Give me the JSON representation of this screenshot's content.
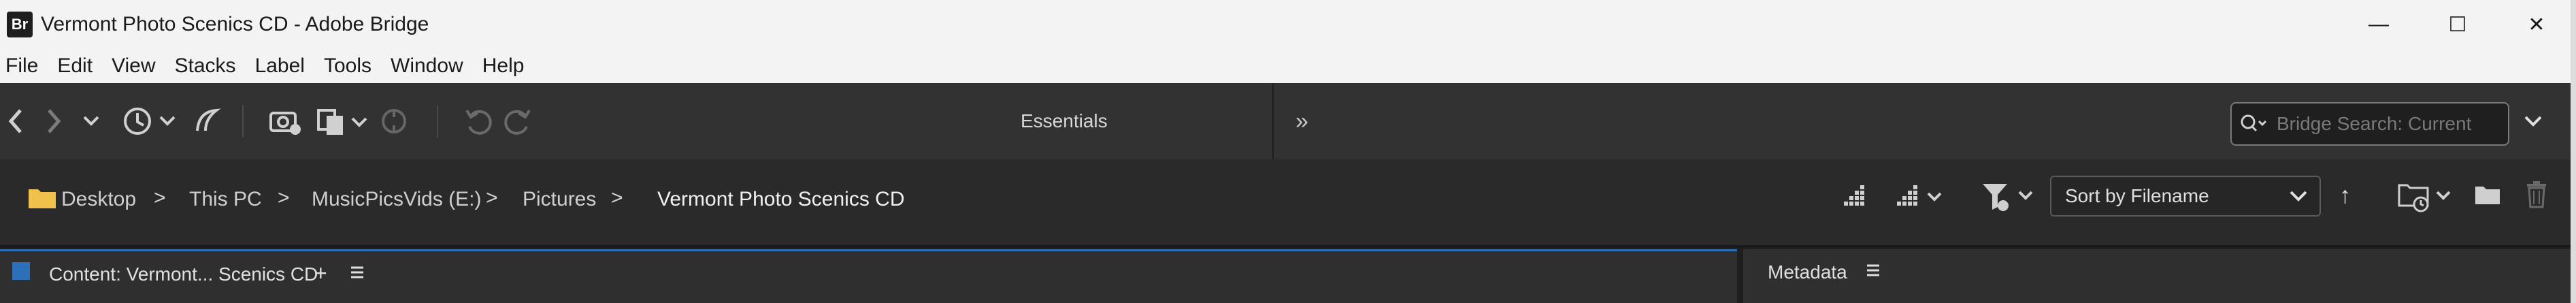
{
  "window": {
    "app_badge": "Br",
    "title": "Vermont Photo Scenics CD - Adobe Bridge",
    "minimize": "—",
    "maximize": "☐",
    "close": "✕"
  },
  "menu": [
    "File",
    "Edit",
    "View",
    "Stacks",
    "Label",
    "Tools",
    "Window",
    "Help"
  ],
  "toolbar": {
    "workspace": "Essentials",
    "more": "»",
    "workspace_menu": "⌄",
    "search_placeholder": "Bridge Search: Current"
  },
  "breadcrumb": {
    "items": [
      "Desktop",
      "This PC",
      "MusicPicsVids (E:)",
      "Pictures",
      "Vermont Photo Scenics CD"
    ],
    "separator": ">"
  },
  "sort": {
    "label": "Sort by Filename",
    "direction": "↑"
  },
  "panels": {
    "content_title": "Content: Vermont... Scenics CD",
    "content_add": "+",
    "metadata_title": "Metadata"
  },
  "colors": {
    "accent": "#2d6fb9",
    "folder": "#f0c24b"
  }
}
